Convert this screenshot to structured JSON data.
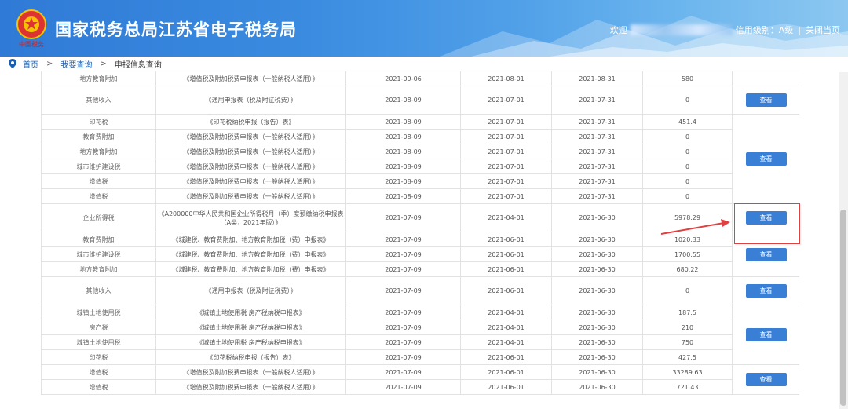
{
  "header": {
    "emblem_text": "中国税务",
    "title": "国家税务总局江苏省电子税务局",
    "welcome": "欢迎",
    "credit": "信用级别：A级",
    "divider": "|",
    "close_page": "关闭当页"
  },
  "breadcrumb": {
    "home": "首页",
    "gt1": ">",
    "level1": "我要查询",
    "gt2": ">",
    "current": "申报信息查询"
  },
  "button_label": "查看",
  "rows": [
    {
      "tax": "地方教育附加",
      "form": "《增值税及附加税费申报表（一般纳税人适用）》",
      "filed": "2021-09-06",
      "start": "2021-08-01",
      "end": "2021-08-31",
      "amount": "580"
    },
    {
      "tax": "其他收入",
      "form": "《通用申报表（税及附征税费）》",
      "filed": "2021-08-09",
      "start": "2021-07-01",
      "end": "2021-07-31",
      "amount": "0"
    },
    {
      "tax": "印花税",
      "form": "《印花税纳税申报（报告）表》",
      "filed": "2021-08-09",
      "start": "2021-07-01",
      "end": "2021-07-31",
      "amount": "451.4"
    },
    {
      "tax": "教育费附加",
      "form": "《增值税及附加税费申报表（一般纳税人适用）》",
      "filed": "2021-08-09",
      "start": "2021-07-01",
      "end": "2021-07-31",
      "amount": "0"
    },
    {
      "tax": "地方教育附加",
      "form": "《增值税及附加税费申报表（一般纳税人适用）》",
      "filed": "2021-08-09",
      "start": "2021-07-01",
      "end": "2021-07-31",
      "amount": "0"
    },
    {
      "tax": "城市维护建设税",
      "form": "《增值税及附加税费申报表（一般纳税人适用）》",
      "filed": "2021-08-09",
      "start": "2021-07-01",
      "end": "2021-07-31",
      "amount": "0"
    },
    {
      "tax": "增值税",
      "form": "《增值税及附加税费申报表（一般纳税人适用）》",
      "filed": "2021-08-09",
      "start": "2021-07-01",
      "end": "2021-07-31",
      "amount": "0"
    },
    {
      "tax": "增值税",
      "form": "《增值税及附加税费申报表（一般纳税人适用）》",
      "filed": "2021-08-09",
      "start": "2021-07-01",
      "end": "2021-07-31",
      "amount": "0"
    },
    {
      "tax": "企业所得税",
      "form": "《A200000中华人民共和国企业所得税月（季）度预缴纳税申报表（A类，2021年版）》",
      "filed": "2021-07-09",
      "start": "2021-04-01",
      "end": "2021-06-30",
      "amount": "5978.29"
    },
    {
      "tax": "教育费附加",
      "form": "《城建税、教育费附加、地方教育附加税（费）申报表》",
      "filed": "2021-07-09",
      "start": "2021-06-01",
      "end": "2021-06-30",
      "amount": "1020.33"
    },
    {
      "tax": "城市维护建设税",
      "form": "《城建税、教育费附加、地方教育附加税（费）申报表》",
      "filed": "2021-07-09",
      "start": "2021-06-01",
      "end": "2021-06-30",
      "amount": "1700.55"
    },
    {
      "tax": "地方教育附加",
      "form": "《城建税、教育费附加、地方教育附加税（费）申报表》",
      "filed": "2021-07-09",
      "start": "2021-06-01",
      "end": "2021-06-30",
      "amount": "680.22"
    },
    {
      "tax": "其他收入",
      "form": "《通用申报表（税及附征税费）》",
      "filed": "2021-07-09",
      "start": "2021-06-01",
      "end": "2021-06-30",
      "amount": "0"
    },
    {
      "tax": "城镇土地使用税",
      "form": "《城镇土地使用税 房产税纳税申报表》",
      "filed": "2021-07-09",
      "start": "2021-04-01",
      "end": "2021-06-30",
      "amount": "187.5"
    },
    {
      "tax": "房产税",
      "form": "《城镇土地使用税 房产税纳税申报表》",
      "filed": "2021-07-09",
      "start": "2021-04-01",
      "end": "2021-06-30",
      "amount": "210"
    },
    {
      "tax": "城镇土地使用税",
      "form": "《城镇土地使用税 房产税纳税申报表》",
      "filed": "2021-07-09",
      "start": "2021-04-01",
      "end": "2021-06-30",
      "amount": "750"
    },
    {
      "tax": "印花税",
      "form": "《印花税纳税申报（报告）表》",
      "filed": "2021-07-09",
      "start": "2021-06-01",
      "end": "2021-06-30",
      "amount": "427.5"
    },
    {
      "tax": "增值税",
      "form": "《增值税及附加税费申报表（一般纳税人适用）》",
      "filed": "2021-07-09",
      "start": "2021-06-01",
      "end": "2021-06-30",
      "amount": "33289.63"
    },
    {
      "tax": "增值税",
      "form": "《增值税及附加税费申报表（一般纳税人适用）》",
      "filed": "2021-07-09",
      "start": "2021-06-01",
      "end": "2021-06-30",
      "amount": "721.43"
    }
  ],
  "colors": {
    "header_blue": "#2f7ad6",
    "button_blue": "#3a7fd6",
    "annotation_red": "#e04040"
  }
}
